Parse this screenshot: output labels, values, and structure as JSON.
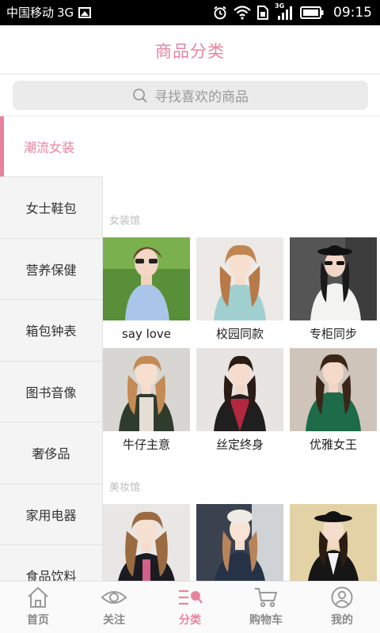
{
  "status_bar": {
    "carrier": "中国移动",
    "network": "3G",
    "signal_badge": "3G",
    "time": "09:15"
  },
  "header": {
    "title": "商品分类"
  },
  "search": {
    "placeholder": "寻找喜欢的商品"
  },
  "sidebar": {
    "items": [
      {
        "label": "潮流女装",
        "active": true
      },
      {
        "label": "女士鞋包"
      },
      {
        "label": "营养保健"
      },
      {
        "label": "箱包钟表"
      },
      {
        "label": "图书音像"
      },
      {
        "label": "奢侈品"
      },
      {
        "label": "家用电器"
      },
      {
        "label": "食品饮料"
      }
    ]
  },
  "content": {
    "sections": [
      {
        "title": "女装馆",
        "products": [
          {
            "label": "say love"
          },
          {
            "label": "校园同款"
          },
          {
            "label": "专柜同步"
          },
          {
            "label": "牛仔主意"
          },
          {
            "label": "丝定终身"
          },
          {
            "label": "优雅女王"
          }
        ]
      },
      {
        "title": "美妆馆",
        "products": [
          {
            "label": ""
          },
          {
            "label": ""
          },
          {
            "label": ""
          }
        ]
      }
    ]
  },
  "tabbar": {
    "tabs": [
      {
        "label": "首页",
        "icon": "home-icon"
      },
      {
        "label": "关注",
        "icon": "eye-icon"
      },
      {
        "label": "分类",
        "icon": "category-icon",
        "active": true
      },
      {
        "label": "购物车",
        "icon": "cart-icon"
      },
      {
        "label": "我的",
        "icon": "user-icon"
      }
    ]
  },
  "colors": {
    "accent": "#e8839e",
    "status_bar": "#000000",
    "sidebar_bg": "#f4f4f4"
  }
}
